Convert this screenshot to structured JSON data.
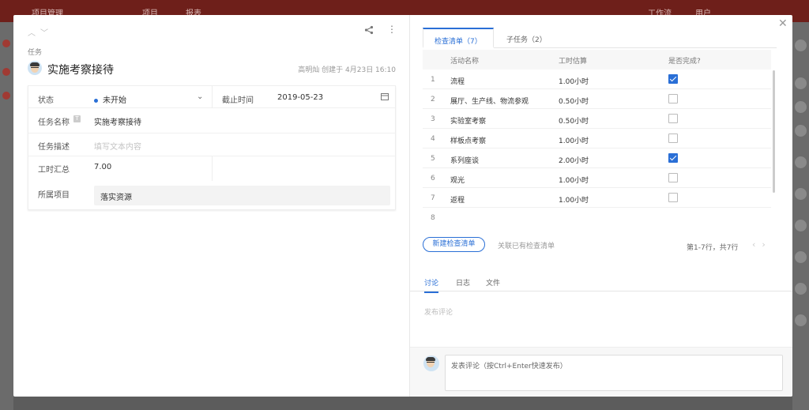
{
  "background": {
    "app_title": "项目管理",
    "nav_project": "项目",
    "nav_report": "报表",
    "nav_workflow": "工作流",
    "nav_users": "用户"
  },
  "header": {
    "type_label": "任务",
    "title": "实施考察接待",
    "meta": "高明灿 创建于 4月23日 16:10"
  },
  "form": {
    "status_label": "状态",
    "status_value": "未开始",
    "deadline_label": "截止时间",
    "deadline_value": "2019-05-23",
    "name_label": "任务名称",
    "name_value": "实施考察接待",
    "desc_label": "任务描述",
    "desc_placeholder": "填写文本内容",
    "hours_label": "工时汇总",
    "hours_value": "7.00",
    "project_label": "所属项目",
    "project_value": "落实资源"
  },
  "tabs": [
    {
      "label": "检查清单（7）"
    },
    {
      "label": "子任务（2）"
    }
  ],
  "checklist": {
    "headers": [
      "活动名称",
      "工时估算",
      "是否完成?"
    ],
    "rows": [
      {
        "num": "1",
        "name": "流程",
        "hours": "1.00小时",
        "done": true
      },
      {
        "num": "2",
        "name": "展厅、生产线、物流参观",
        "hours": "0.50小时",
        "done": false
      },
      {
        "num": "3",
        "name": "实验室考察",
        "hours": "0.50小时",
        "done": false
      },
      {
        "num": "4",
        "name": "样板点考察",
        "hours": "1.00小时",
        "done": false
      },
      {
        "num": "5",
        "name": "系列座谈",
        "hours": "2.00小时",
        "done": true
      },
      {
        "num": "6",
        "name": "观光",
        "hours": "1.00小时",
        "done": false
      },
      {
        "num": "7",
        "name": "返程",
        "hours": "1.00小时",
        "done": false
      }
    ],
    "empty_row_num": "8",
    "new_button": "新建检查清单",
    "link_label": "关联已有检查清单",
    "pager_text": "第1-7行，共7行"
  },
  "bottom_tabs": [
    "讨论",
    "日志",
    "文件"
  ],
  "comments": {
    "hint": "发布评论",
    "input_placeholder": "发表评论（按Ctrl+Enter快速发布）"
  }
}
